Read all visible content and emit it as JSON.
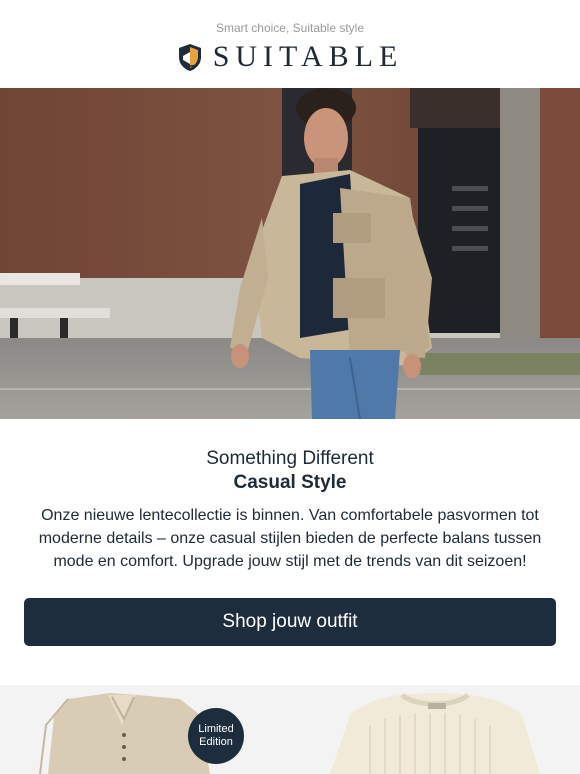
{
  "header": {
    "tagline": "Smart choice, Suitable style",
    "brand": "SUITABLE",
    "logo_icon": "crest-shield-icon"
  },
  "hero": {
    "image": "man-in-beige-jacket-walking-photo"
  },
  "content": {
    "eyebrow": "Something Different",
    "headline": "Casual Style",
    "body": "Onze nieuwe lentecollectie is binnen. Van comfortabele pasvormen tot moderne details – onze casual stijlen bieden de perfecte balans tussen mode en comfort. Upgrade jouw stijl met de trends van dit seizoen!"
  },
  "cta": {
    "label": "Shop jouw outfit"
  },
  "products": {
    "badge_line1": "Limited",
    "badge_line2": "Edition",
    "items": [
      {
        "image": "beige-polo-shirt-photo"
      },
      {
        "image": "cream-knit-sweater-photo"
      }
    ]
  },
  "colors": {
    "navy": "#1e2d3d",
    "text": "#1e2a38",
    "muted": "#9a9a9a",
    "product_bg": "#f3f3f3"
  }
}
